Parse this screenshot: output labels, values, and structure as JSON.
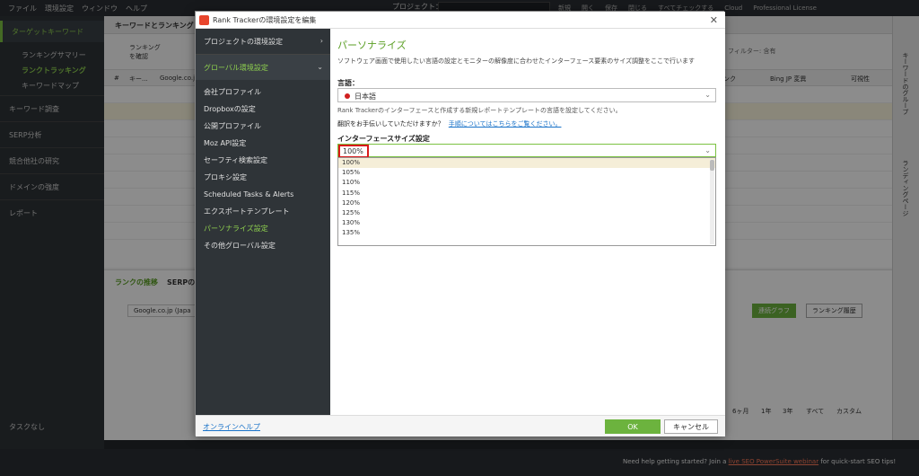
{
  "menubar": {
    "items": [
      "ファイル",
      "環境設定",
      "ウィンドウ",
      "ヘルプ"
    ],
    "project_label": "プロジェクト："
  },
  "toolbar_right": {
    "items": [
      "新規",
      "開く",
      "保存",
      "閉じる",
      "すべてチェックする",
      "Cloud",
      "Professional License"
    ]
  },
  "sidebar": {
    "target_keywords": "ターゲットキーワード",
    "subs": [
      "ランキングサマリー",
      "ランクトラッキング",
      "キーワードマップ"
    ],
    "sections": [
      "キーワード調査",
      "SERP分析",
      "競合他社の研究",
      "ドメインの強度",
      "レポート"
    ],
    "tasks": "タスクなし"
  },
  "main": {
    "tab_title": "キーワードとランキング",
    "check_rank": "ランキング\nを確認",
    "filter_placeholder": "フィルター: 含有",
    "grid_headers": [
      "#",
      "キー...",
      "Google.co.jp",
      "ンク",
      "Bing JP 変異",
      "可視性"
    ],
    "lower_tabs": [
      "ランクの推移",
      "SERPの..."
    ],
    "engine_select": "Google.co.jp (Japa",
    "graph_btn": "連続グラフ",
    "history_btn": "ランキング履歴",
    "ranges": [
      "6ヶ月",
      "1年",
      "3年",
      "すべて",
      "カスタム"
    ]
  },
  "rightbar": {
    "tab1": "キーワードのグループ",
    "tab2": "ランディングページ"
  },
  "bottombar": {
    "pre": "Need help getting started? Join a ",
    "link": "live SEO PowerSuite webinar",
    "post": " for quick-start SEO tips!"
  },
  "dialog": {
    "title": "Rank Trackerの環境設定を編集",
    "left": {
      "project_settings": "プロジェクトの環境設定",
      "global_settings": "グローバル環境設定",
      "items": [
        "会社プロファイル",
        "Dropboxの設定",
        "公開プロファイル",
        "Moz API設定",
        "セーフティ検索設定",
        "プロキシ設定",
        "Scheduled Tasks & Alerts",
        "エクスポートテンプレート",
        "パーソナライズ設定",
        "その他グローバル設定"
      ]
    },
    "right": {
      "title": "パーソナライズ",
      "desc": "ソフトウェア画面で使用したい言語の設定とモニターの解像度に合わせたインターフェース要素のサイズ調整をここで行います",
      "lang_label": "言語：",
      "lang_value": "日本語",
      "lang_note": "Rank Trackerのインターフェースと作成する新規レポートテンプレートの言語を設定してください。",
      "trans_q": "翻訳をお手伝いしていただけますか？",
      "trans_link": "手順についてはこちらをご覧ください。",
      "size_label": "インターフェースサイズ設定",
      "size_value": "100%",
      "size_options": [
        "100%",
        "105%",
        "110%",
        "115%",
        "120%",
        "125%",
        "130%",
        "135%"
      ]
    },
    "footer": {
      "help": "オンラインヘルプ",
      "ok": "OK",
      "cancel": "キャンセル"
    }
  }
}
